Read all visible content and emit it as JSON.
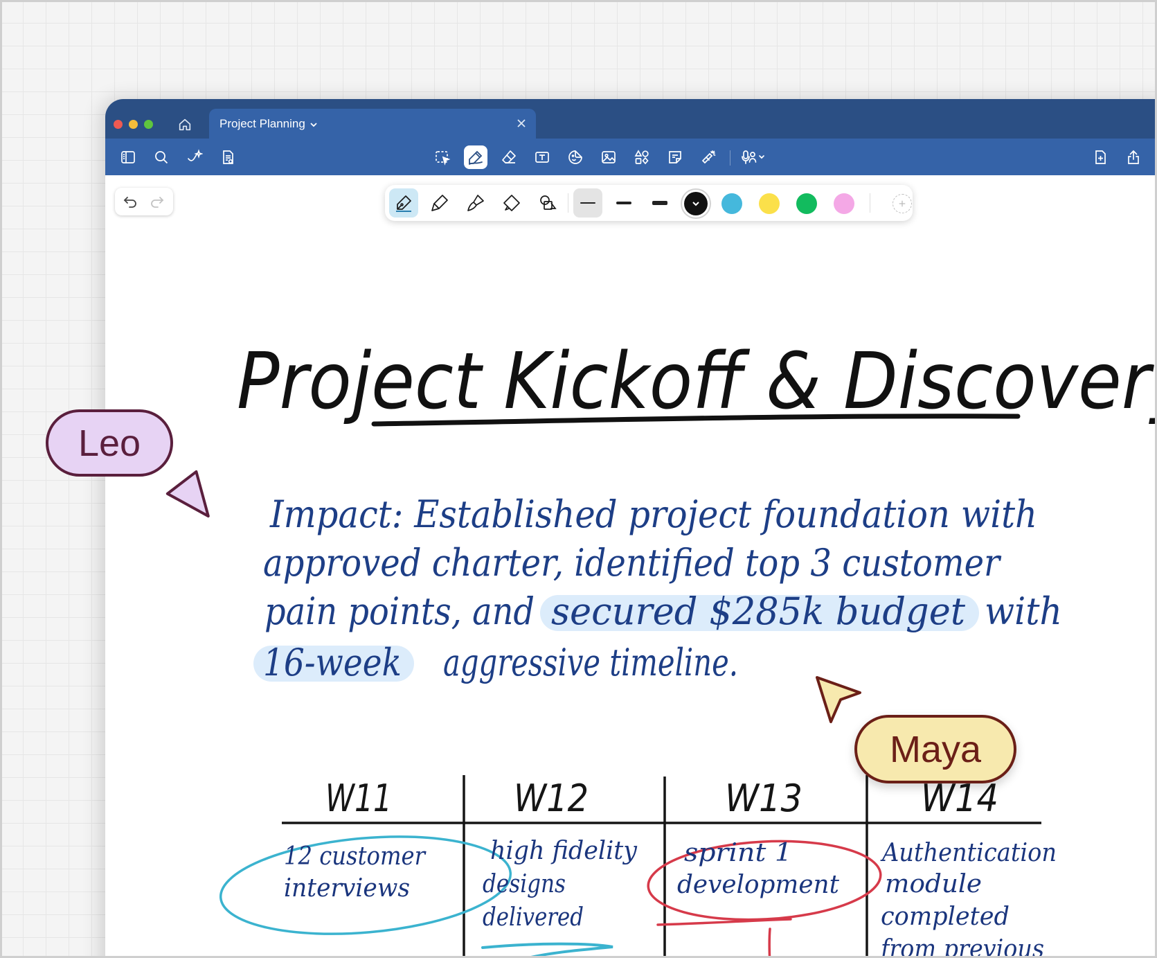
{
  "window": {
    "tab_title": "Project Planning",
    "tab_close": "×"
  },
  "toolbar": {
    "left_icons": [
      "sidebar-icon",
      "search-icon",
      "ai-sparkle-icon",
      "document-outline-icon"
    ],
    "center_icons": [
      "lasso-select-icon",
      "pen-tool-icon",
      "eraser-icon",
      "text-box-icon",
      "sticker-icon",
      "image-icon",
      "shapes-icon",
      "sticky-note-icon",
      "laser-pointer-icon",
      "audio-record-icon"
    ],
    "right_icons": [
      "add-page-icon",
      "share-icon"
    ],
    "active_tool": "pen"
  },
  "pen_bar": {
    "tools": [
      "fountain-pen",
      "ballpoint-pen",
      "brush-pen",
      "highlighter",
      "shape-pen"
    ],
    "selected_tool": "fountain-pen",
    "widths": [
      "thin",
      "medium",
      "thick"
    ],
    "selected_width": "thin",
    "colors": [
      "#111111",
      "#45b8dc",
      "#fbe04a",
      "#12bb5e",
      "#f4a8e6"
    ],
    "selected_color": "#111111"
  },
  "note": {
    "title": "Project Kickoff & Discovery",
    "impact_lines": [
      "Impact: Established project foundation with",
      "approved charter, identified top 3 customer",
      "pain points, and",
      "secured $285k budget",
      "with",
      "16-week",
      "aggressive timeline."
    ],
    "highlight_color": "#dcecfb",
    "weeks": [
      "W11",
      "W12",
      "W13",
      "W14"
    ],
    "cells": [
      [
        "12 customer",
        "interviews"
      ],
      [
        "high fidelity",
        "designs",
        "delivered"
      ],
      [
        "sprint 1",
        "development"
      ],
      [
        "Authentication",
        "module",
        "completed",
        "from previous"
      ]
    ]
  },
  "collaborators": [
    {
      "name": "Leo",
      "color": "#e7d3f4",
      "border": "#5a1f3d"
    },
    {
      "name": "Maya",
      "color": "#f7e9ae",
      "border": "#6b1f17"
    }
  ]
}
